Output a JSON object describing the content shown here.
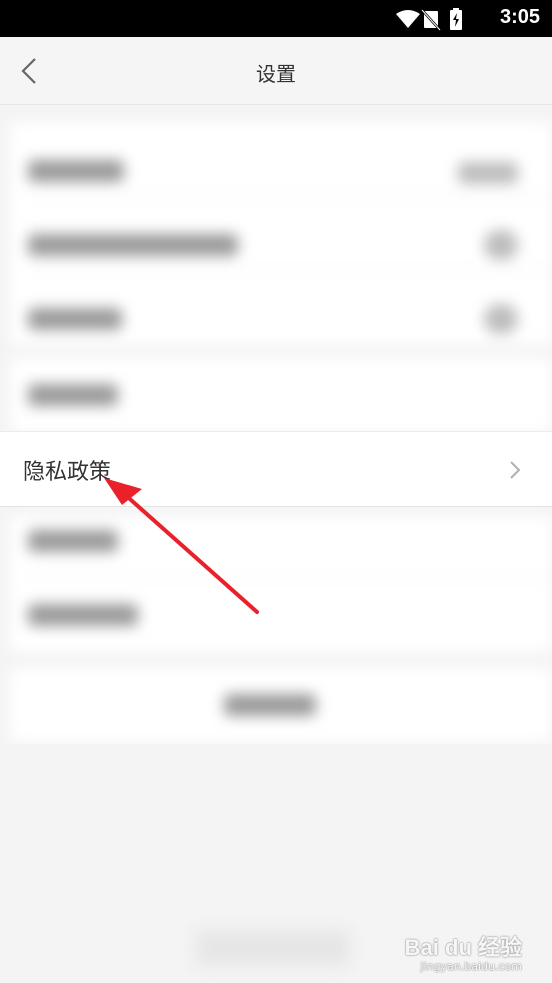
{
  "status_bar": {
    "time": "3:05"
  },
  "header": {
    "title": "设置"
  },
  "privacy_item": {
    "label": "隐私政策"
  },
  "watermark": {
    "brand": "Bai du 经验",
    "url": "jingyan.baidu.com"
  },
  "colors": {
    "annotation_arrow": "#e8212a",
    "background": "#f4f4f4"
  }
}
